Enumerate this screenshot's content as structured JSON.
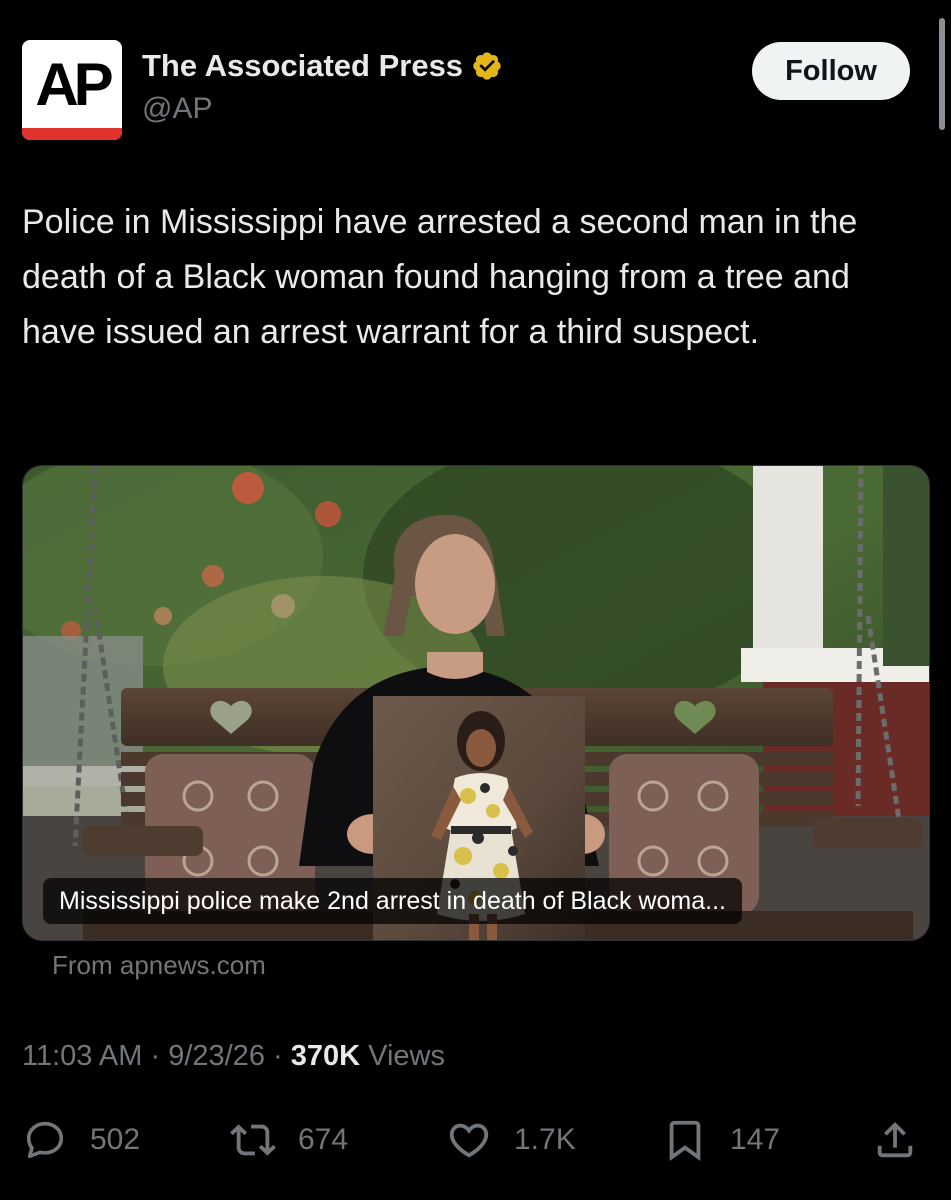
{
  "account": {
    "avatar_text": "AP",
    "display_name": "The Associated Press",
    "handle": "@AP",
    "follow_label": "Follow"
  },
  "tweet": {
    "text": "Police in Mississippi have arrested a second man in the death of a Black woman found hanging from a tree and have issued an arrest warrant for a third suspect."
  },
  "card": {
    "headline": "Mississippi police make 2nd arrest in death of Black woma...",
    "source": "From apnews.com"
  },
  "meta": {
    "time": "11:03 AM",
    "date": "9/23/26",
    "views_count": "370K",
    "views_label": "Views",
    "separator": "·"
  },
  "actions": {
    "replies": "502",
    "reposts": "674",
    "likes": "1.7K",
    "bookmarks": "147"
  },
  "colors": {
    "background": "#000000",
    "text_primary": "#e7e9ea",
    "text_secondary": "#71767b",
    "verified_gold": "#e2b719",
    "ap_red": "#e0332d"
  },
  "icons": [
    "verified-badge-icon",
    "reply-icon",
    "repost-icon",
    "like-icon",
    "bookmark-icon",
    "share-icon"
  ]
}
